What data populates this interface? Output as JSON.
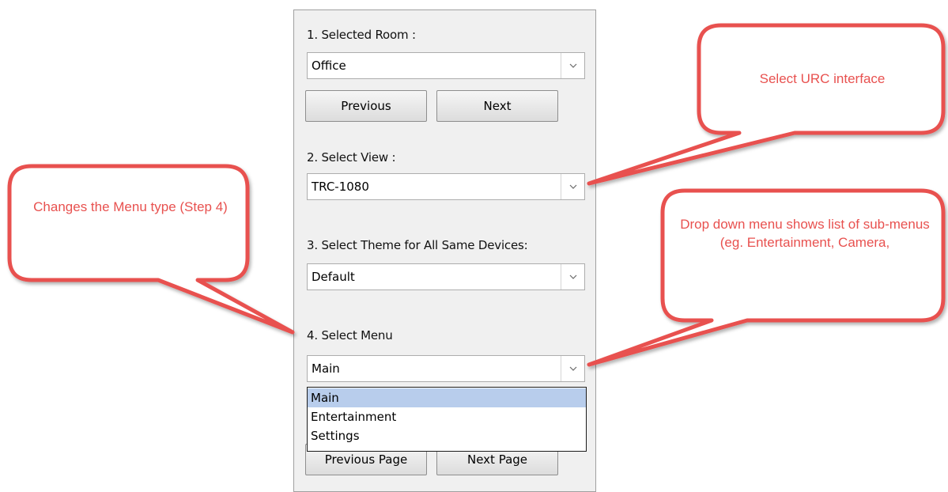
{
  "panel": {
    "room_label": "1. Selected Room :",
    "room_value": "Office",
    "previous_label": "Previous",
    "next_label": "Next",
    "view_label": "2. Select View :",
    "view_value": "TRC-1080",
    "theme_label": "3. Select Theme for All Same Devices:",
    "theme_value": "Default",
    "menu_label": "4. Select Menu",
    "menu_value": "Main",
    "menu_options": [
      "Main",
      "Entertainment",
      "Settings"
    ],
    "previous_page_label": "Previous Page",
    "next_page_label": "Next Page"
  },
  "callouts": {
    "urc": "Select URC interface",
    "menu_type": "Changes the Menu type (Step 4)",
    "dropdown": "Drop down menu shows list of sub-menus (eg. Entertainment, Camera,"
  },
  "colors": {
    "callout": "#e8514f",
    "selected_option": "#b8cdec",
    "panel_bg": "#f0f0f0"
  }
}
